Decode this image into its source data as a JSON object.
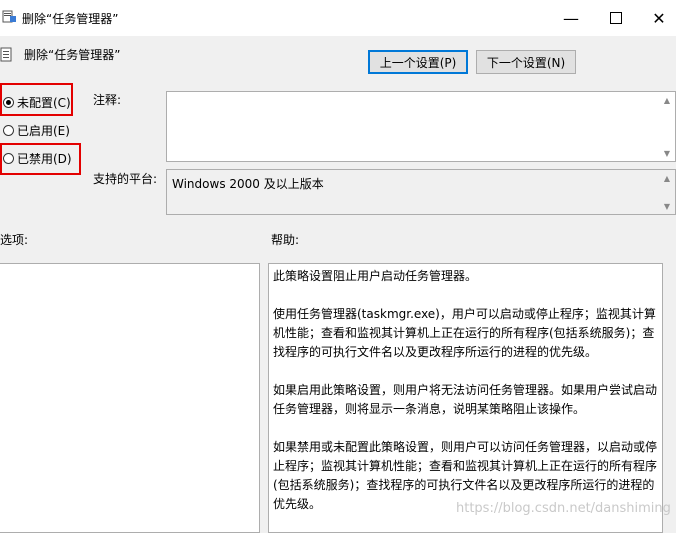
{
  "window": {
    "title": "删除“任务管理器”",
    "minimize_icon": "minimize-icon",
    "maximize_icon": "maximize-icon",
    "close_icon": "close-icon"
  },
  "header": {
    "policy_title": "删除“任务管理器”",
    "prev_button": "上一个设置(P)",
    "next_button": "下一个设置(N)"
  },
  "state_options": [
    {
      "label": "未配置(C)",
      "checked": true
    },
    {
      "label": "已启用(E)",
      "checked": false
    },
    {
      "label": "已禁用(D)",
      "checked": false
    }
  ],
  "comment_label": "注释:",
  "comment_value": "",
  "platform_label": "支持的平台:",
  "platform_value": "Windows 2000 及以上版本",
  "options_label": "选项:",
  "help_label": "帮助:",
  "help_text": [
    [
      "此策略设置阻止用户启动任务管理器。"
    ],
    [
      "使用任务管理器(taskmgr.exe)，用户可以启动或停止程序；监视其计算",
      "机性能；查看和监视其计算机上正在运行的所有程序(包括系统服务)；查",
      "找程序的可执行文件名以及更改程序所运行的进程的优先级。"
    ],
    [
      "如果启用此策略设置，则用户将无法访问任务管理器。如果用户尝试启动",
      "任务管理器，则将显示一条消息，说明某策略阻止该操作。"
    ],
    [
      "如果禁用或未配置此策略设置，则用户可以访问任务管理器，以启动或停",
      "止程序；监视其计算机性能；查看和监视其计算机上正在运行的所有程序",
      "(包括系统服务)；查找程序的可执行文件名以及更改程序所运行的进程的",
      "优先级。"
    ]
  ],
  "watermark": "https://blog.csdn.net/danshiming",
  "colors": {
    "highlight": "#e30000",
    "focus": "#0078d7"
  }
}
